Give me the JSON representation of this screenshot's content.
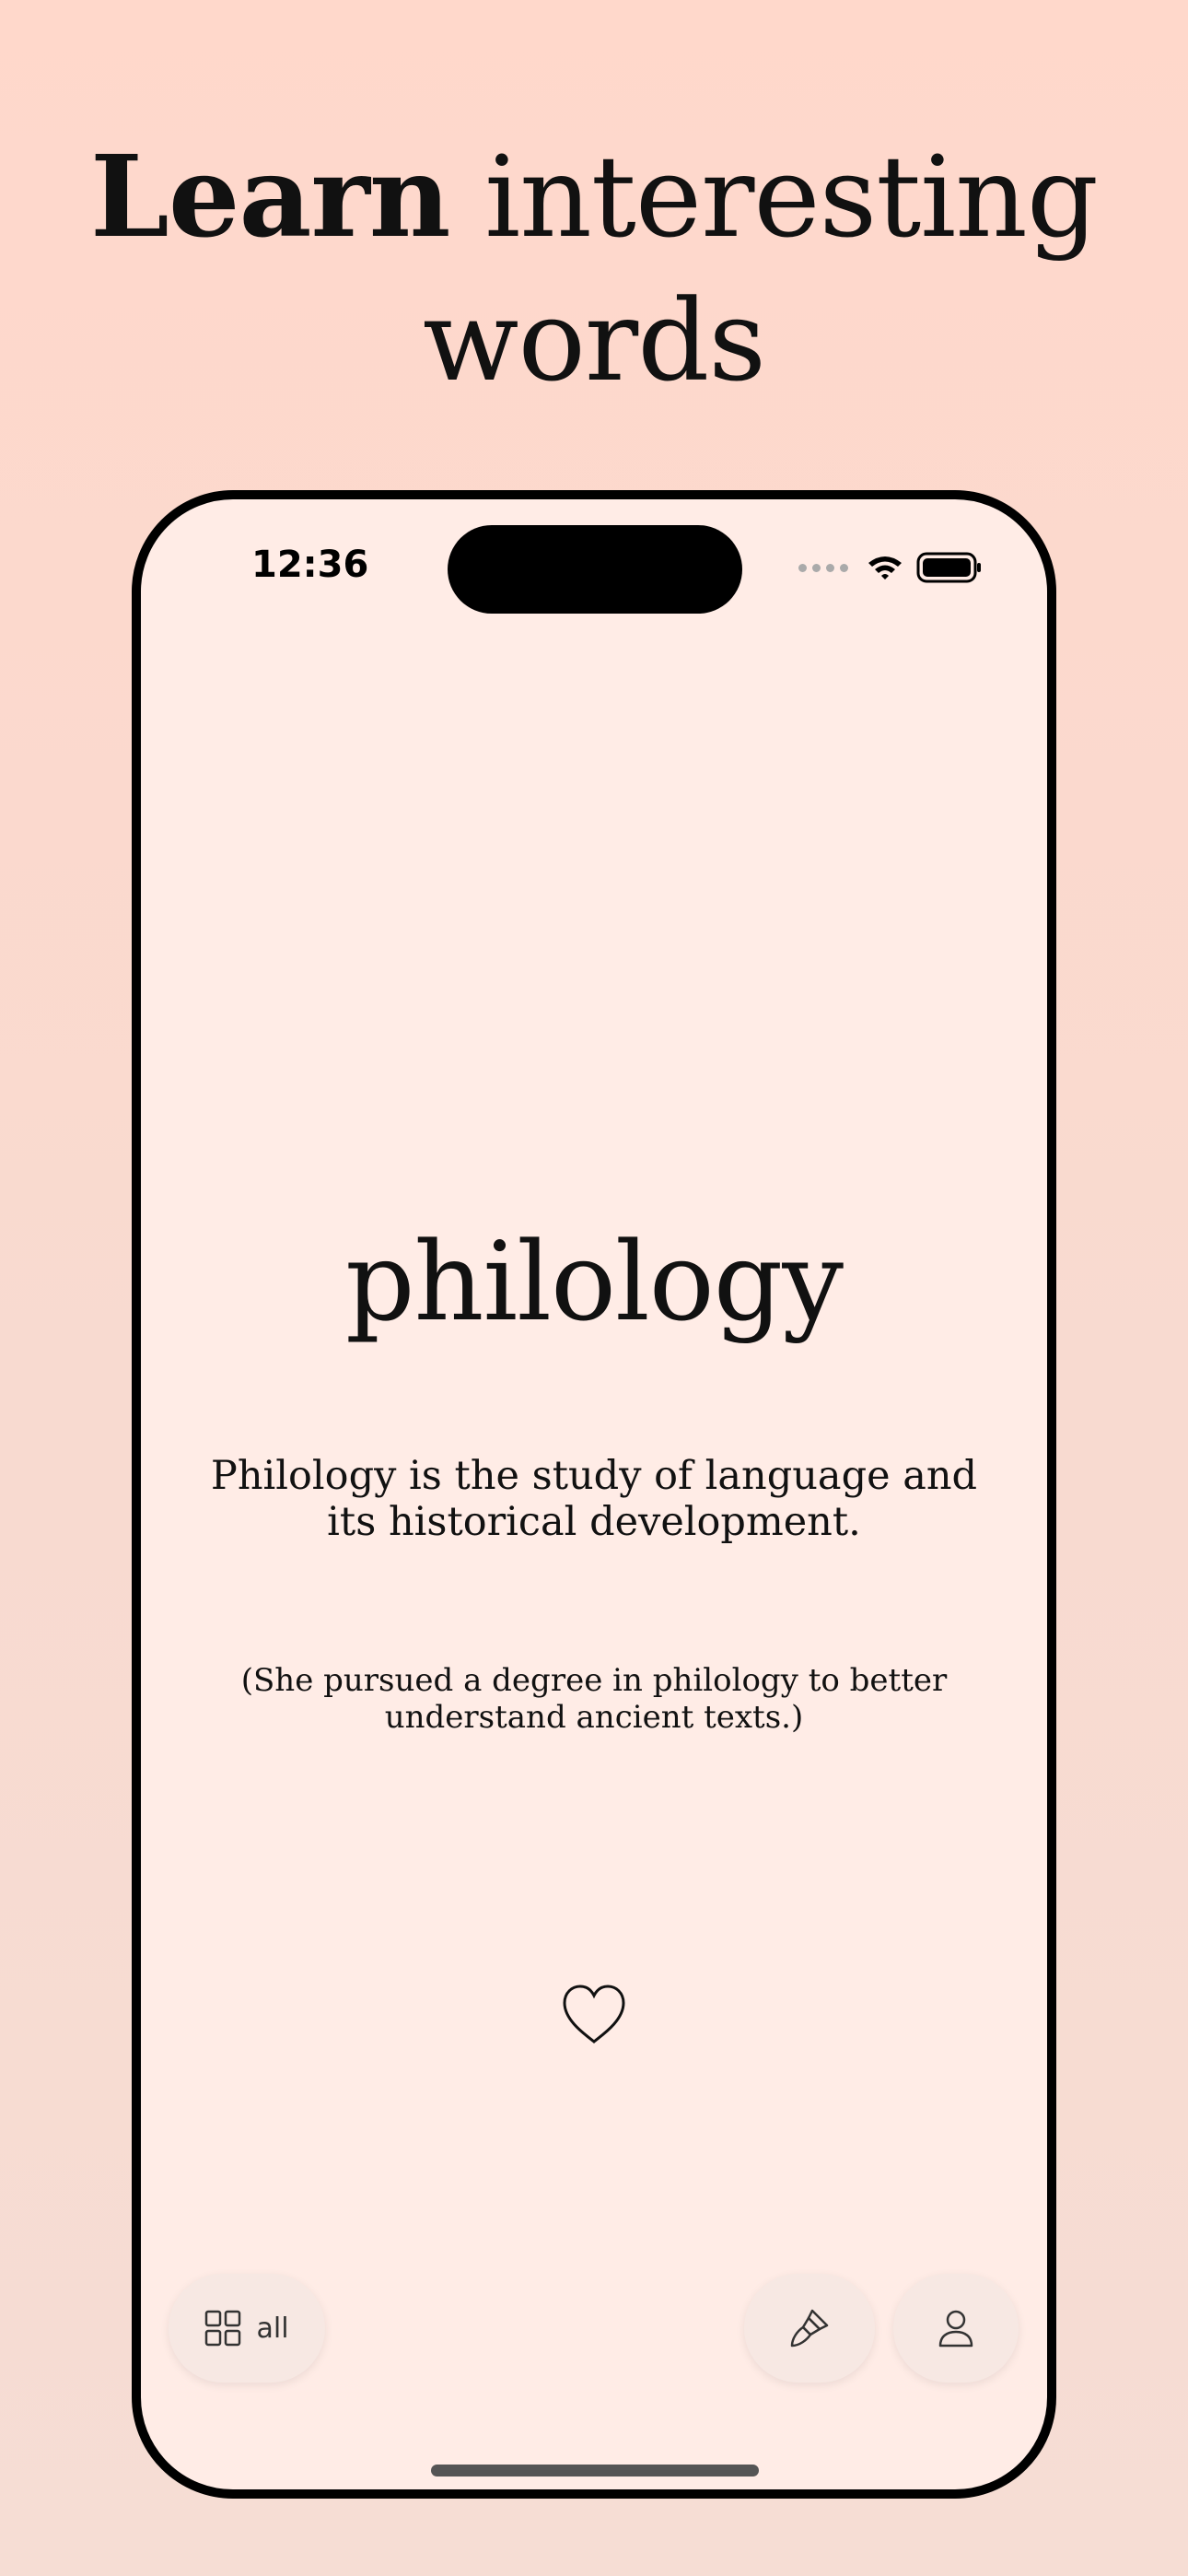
{
  "headline": {
    "bold": "Learn",
    "rest": " interesting",
    "line2": "words"
  },
  "status_bar": {
    "time": "12:36"
  },
  "card": {
    "word": "philology",
    "definition": "Philology is the study of language and its historical development.",
    "example": "(She pursued a degree in philology to better understand ancient texts.)"
  },
  "bottom_bar": {
    "categories_label": "all"
  },
  "icons": {
    "status": [
      "cellular-signal-icon",
      "wifi-icon",
      "battery-icon"
    ],
    "card": [
      "heart-icon"
    ],
    "bottom_bar": [
      "grid-icon",
      "brush-icon",
      "profile-icon"
    ]
  },
  "colors": {
    "background": "#ffd8cb",
    "screen": "#ffece6",
    "pill": "#f7e8e3",
    "text": "#111111"
  }
}
